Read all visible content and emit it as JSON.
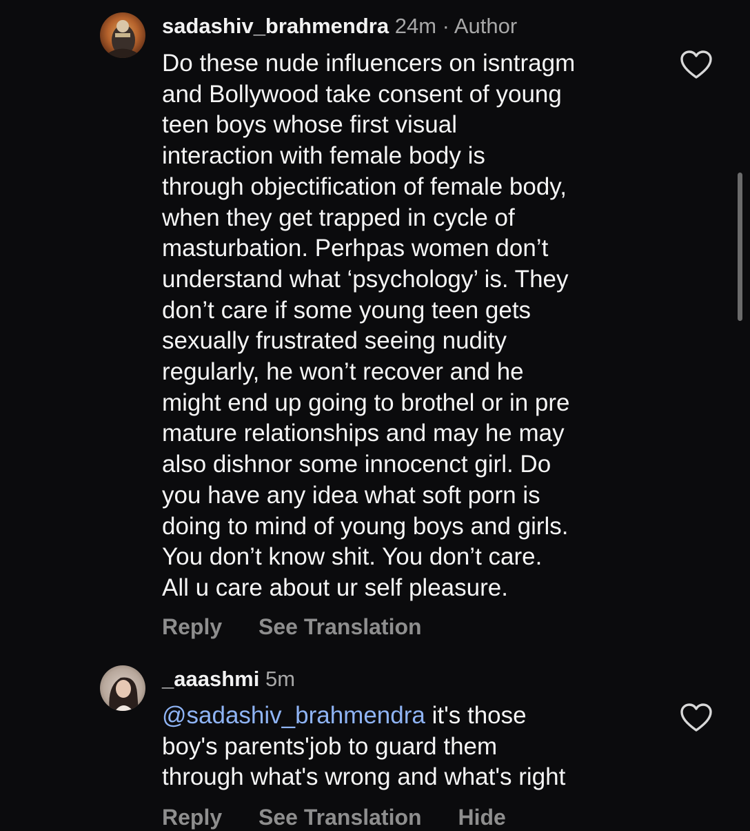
{
  "comments": [
    {
      "username": "sadashiv_brahmendra",
      "meta": "24m · Author",
      "lines": [
        "Do these nude influencers on isntragm",
        "and Bollywood take consent of young",
        "teen boys whose first visual",
        "interaction with female body is",
        "through objectification of female body,",
        "when they get trapped in cycle of",
        "masturbation. Perhpas women don’t",
        "understand what ‘psychology’ is. They",
        "don’t care if some young teen gets",
        "sexually frustrated seeing nudity",
        "regularly, he won’t recover and he",
        "might end up going to brothel or in pre",
        "mature relationships and may he may",
        "also dishnor some innocenct girl. Do",
        "you have any idea what soft porn is",
        "doing to mind of young boys and girls.",
        "You don’t know shit. You don’t care.",
        "All u care about ur self pleasure."
      ],
      "actions": {
        "reply": "Reply",
        "translate": "See Translation"
      },
      "like_icon": "heart-outline-icon"
    },
    {
      "username": "_aaashmi",
      "meta": "5m",
      "mention": "@sadashiv_brahmendra",
      "first_line_rest": " it's those",
      "lines": [
        "boy's parents'job to guard them",
        "through what's wrong and what's right"
      ],
      "actions": {
        "reply": "Reply",
        "translate": "See Translation",
        "hide": "Hide"
      },
      "like_icon": "heart-outline-icon"
    }
  ],
  "colors": {
    "background": "#0b0b0d",
    "text": "#f5f5f5",
    "meta": "#a8a8a8",
    "action": "#8e8e8e",
    "mention": "#8fb4f5"
  }
}
